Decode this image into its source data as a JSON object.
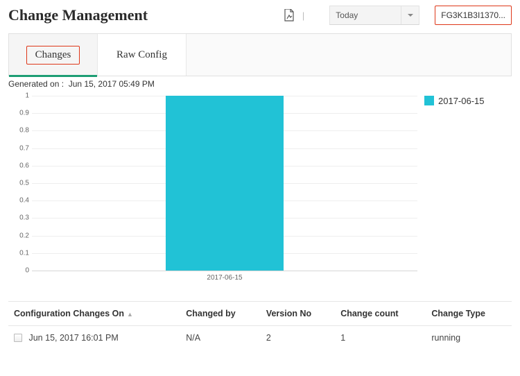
{
  "header": {
    "title": "Change Management",
    "date_filter": "Today",
    "device_id": "FG3K1B3I1370..."
  },
  "tabs": {
    "changes": "Changes",
    "raw_config": "Raw Config"
  },
  "generated_label": "Generated on :",
  "generated_value": "Jun 15, 2017 05:49 PM",
  "chart_data": {
    "type": "bar",
    "categories": [
      "2017-06-15"
    ],
    "values": [
      1
    ],
    "ylim": [
      0,
      1
    ],
    "yticks": [
      0,
      0.1,
      0.2,
      0.3,
      0.4,
      0.5,
      0.6,
      0.7,
      0.8,
      0.9,
      1
    ],
    "legend": "2017-06-15",
    "bar_color": "#21c2d6"
  },
  "table": {
    "columns": {
      "c0": "Configuration Changes On",
      "c1": "Changed by",
      "c2": "Version No",
      "c3": "Change count",
      "c4": "Change Type"
    },
    "rows": [
      {
        "c0": "Jun 15, 2017 16:01 PM",
        "c1": "N/A",
        "c2": "2",
        "c3": "1",
        "c4": "running"
      }
    ]
  }
}
